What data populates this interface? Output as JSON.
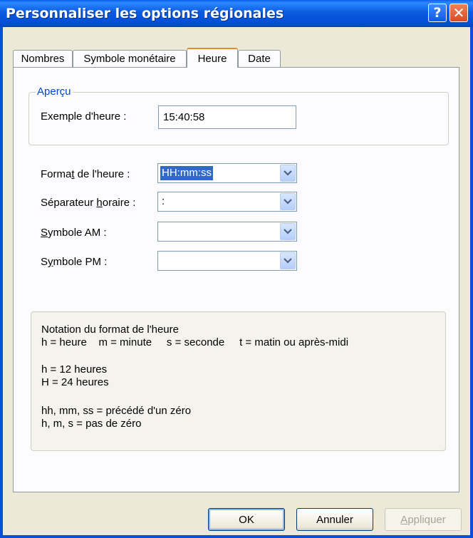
{
  "window": {
    "title": "Personnaliser les options régionales",
    "help_label": "?",
    "close_label": "✕"
  },
  "tabs": [
    {
      "label": "Nombres"
    },
    {
      "label": "Symbole monétaire"
    },
    {
      "label": "Heure"
    },
    {
      "label": "Date"
    }
  ],
  "active_tab": "Heure",
  "preview": {
    "legend": "Aperçu",
    "example_label": "Exemple d'heure :",
    "example_value": "15:40:58"
  },
  "fields": {
    "format": {
      "label_pre": "Forma",
      "label_u": "t",
      "label_post": " de l'heure :",
      "value": "HH:mm:ss"
    },
    "separator": {
      "label_pre": "Séparateur ",
      "label_u": "h",
      "label_post": "oraire :",
      "value": ":"
    },
    "am": {
      "label_pre": "",
      "label_u": "S",
      "label_post": "ymbole AM :",
      "value": ""
    },
    "pm": {
      "label_pre": "S",
      "label_u": "y",
      "label_post": "mbole PM :",
      "value": ""
    }
  },
  "notation": {
    "title": "Notation du format de l'heure",
    "line1": "h = heure    m = minute     s = seconde     t = matin ou après-midi",
    "line2": "h = 12 heures",
    "line3": "H = 24 heures",
    "line4": "hh, mm, ss = précédé d'un zéro",
    "line5": "h, m, s = pas de zéro"
  },
  "buttons": {
    "ok": "OK",
    "cancel": "Annuler",
    "apply_pre": "",
    "apply_u": "A",
    "apply_post": "ppliquer"
  },
  "colors": {
    "title_bar": "#0a5be0",
    "accent": "#316ac5",
    "dialog_bg": "#ece9d8",
    "legend_text": "#0046d5"
  }
}
